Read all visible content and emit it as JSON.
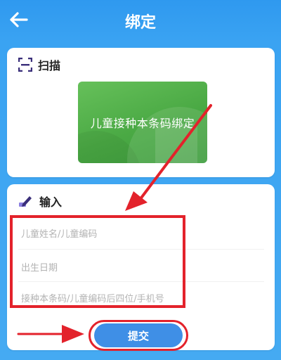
{
  "header": {
    "title": "绑定",
    "back_icon": "arrow-left-icon"
  },
  "scan": {
    "label": "扫描",
    "icon": "scan-frame-icon",
    "barcode_button_label": "儿童接种本条码绑定"
  },
  "input": {
    "label": "输入",
    "icon": "pencil-icon",
    "fields": {
      "child_name_placeholder": "儿童姓名/儿童编码",
      "birth_date_placeholder": "出生日期",
      "code_placeholder": "接种本条码/儿童编码后四位/手机号"
    }
  },
  "submit": {
    "label": "提交"
  },
  "colors": {
    "header_blue": "#2f99ef",
    "card_green": "#4aa944",
    "button_blue": "#3f8fe6",
    "annotation_red": "#e3222b"
  }
}
